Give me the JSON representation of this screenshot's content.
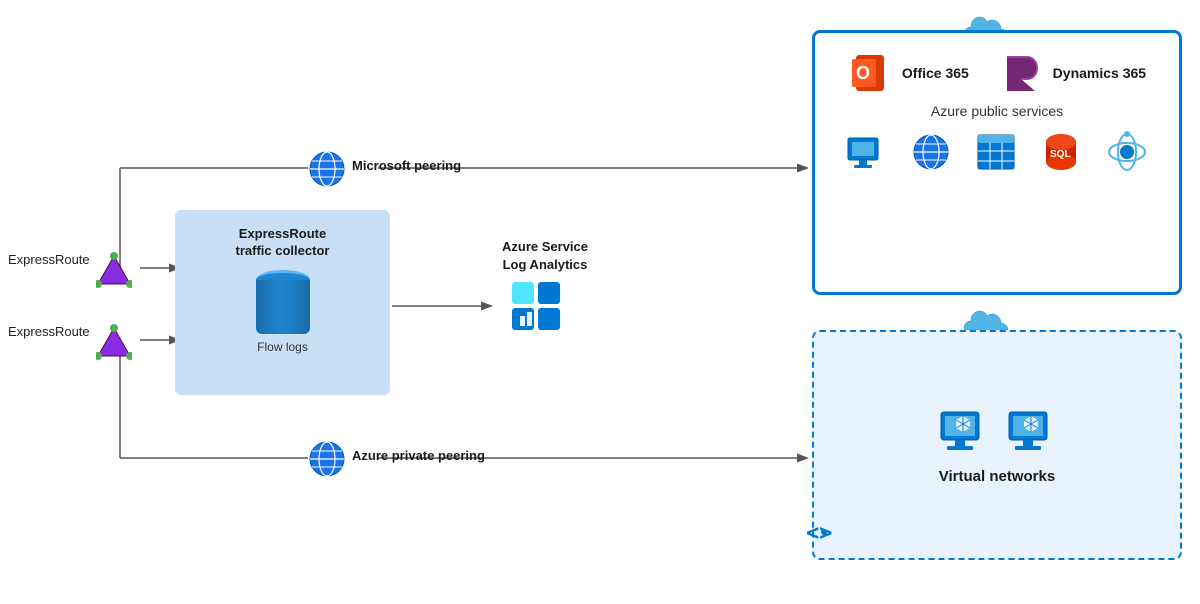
{
  "labels": {
    "expressRoute1": "ExpressRoute",
    "expressRoute2": "ExpressRoute",
    "microsoftPeering": "Microsoft peering",
    "azurePrivatePeering": "Azure private peering",
    "trafficCollectorTitle": "ExpressRoute\ntraffic collector",
    "flowLogs": "Flow logs",
    "logAnalyticsTitle": "Azure Service\nLog Analytics",
    "azurePublicServices": "Azure public services",
    "virtualNetworks": "Virtual networks",
    "office365": "Office 365",
    "dynamics365": "Dynamics 365"
  },
  "colors": {
    "blue": "#0078d4",
    "lightBlue": "#c9dff5",
    "arrowColor": "#555",
    "textDark": "#1a1a1a"
  }
}
